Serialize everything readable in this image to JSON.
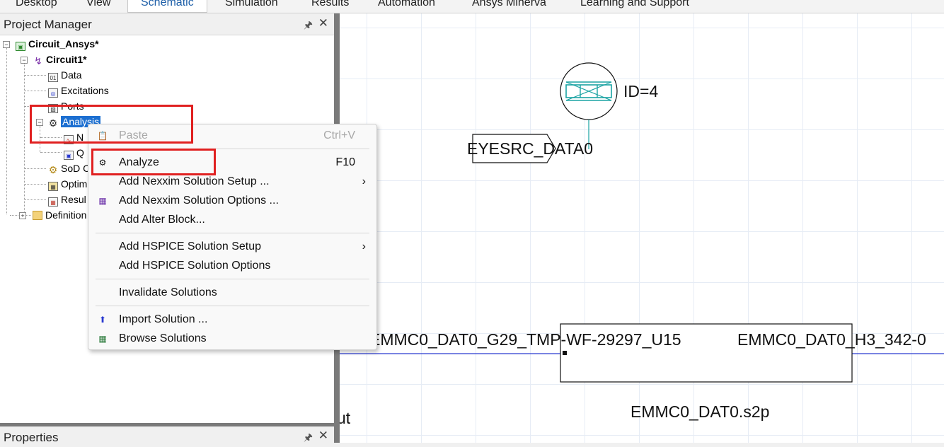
{
  "tabs": [
    "Desktop",
    "View",
    "Schematic",
    "Simulation",
    "Results",
    "Automation",
    "Ansys Minerva",
    "Learning and Support"
  ],
  "project_manager": {
    "title": "Project Manager",
    "tree": {
      "project": "Circuit_Ansys*",
      "design": "Circuit1*",
      "data": "Data",
      "excitations": "Excitations",
      "ports": "Ports",
      "analysis": "Analysis",
      "analysis_child1": "N",
      "analysis_child2": "Q",
      "sod": "SoD C",
      "optim": "Optim",
      "results": "Resul",
      "definitions": "Definition"
    }
  },
  "properties": {
    "title": "Properties"
  },
  "context_menu": {
    "paste": {
      "label": "Paste",
      "shortcut": "Ctrl+V"
    },
    "analyze": {
      "label": "Analyze",
      "shortcut": "F10"
    },
    "add_nexxim_setup": "Add Nexxim Solution Setup ...",
    "add_nexxim_options": "Add Nexxim Solution Options ...",
    "add_alter_block": "Add Alter Block...",
    "add_hspice_setup": "Add HSPICE Solution Setup",
    "add_hspice_options": "Add HSPICE Solution Options",
    "invalidate_solutions": "Invalidate Solutions",
    "import_solution": "Import Solution ...",
    "browse_solutions": "Browse Solutions"
  },
  "schematic": {
    "component_id": "ID=4",
    "port_label": "EYESRC_DATA0",
    "net_left": "EMMC0_DAT0_G29_TMP-WF-29297_U15",
    "net_right": "EMMC0_DAT0_H3_342-0",
    "sparam_file": "EMMC0_DAT0.s2p",
    "partial_text": "ut"
  },
  "colors": {
    "selection": "#1c6fd1",
    "highlight": "#e02020",
    "wire": "#2a3ad0",
    "teal": "#1ba3a3"
  }
}
